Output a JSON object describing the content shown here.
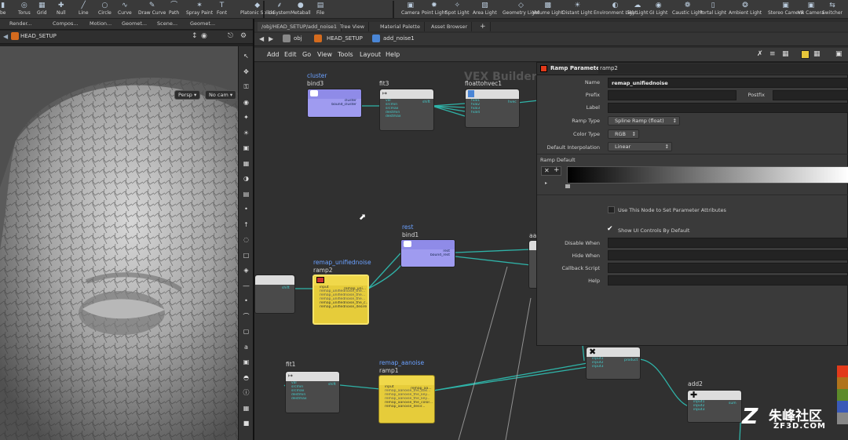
{
  "shelf": {
    "left_tools": [
      {
        "label": "be",
        "icon": "tube-icon"
      },
      {
        "label": "Torus",
        "icon": "torus-icon"
      },
      {
        "label": "Grid",
        "icon": "grid-icon"
      },
      {
        "label": "Null",
        "icon": "null-icon"
      },
      {
        "label": "Line",
        "icon": "line-icon"
      },
      {
        "label": "Circle",
        "icon": "circle-icon"
      },
      {
        "label": "Curve",
        "icon": "curve-icon"
      },
      {
        "label": "Draw Curve",
        "icon": "draw-curve-icon"
      },
      {
        "label": "Path",
        "icon": "path-icon"
      },
      {
        "label": "Spray Paint",
        "icon": "spray-paint-icon"
      },
      {
        "label": "Font",
        "icon": "font-icon"
      },
      {
        "label": "Platonic Solids",
        "icon": "platonic-icon"
      },
      {
        "label": "L-System",
        "icon": "lsystem-icon"
      },
      {
        "label": "Metaball",
        "icon": "metaball-icon"
      },
      {
        "label": "File",
        "icon": "file-icon"
      }
    ],
    "right_tools": [
      {
        "label": "Camera",
        "icon": "camera-icon"
      },
      {
        "label": "Point Light",
        "icon": "point-light-icon"
      },
      {
        "label": "Spot Light",
        "icon": "spot-light-icon"
      },
      {
        "label": "Area Light",
        "icon": "area-light-icon"
      },
      {
        "label": "Geometry Light",
        "icon": "geometry-light-icon"
      },
      {
        "label": "Volume Light",
        "icon": "volume-light-icon"
      },
      {
        "label": "Distant Light",
        "icon": "distant-light-icon"
      },
      {
        "label": "Environment Light",
        "icon": "environment-light-icon"
      },
      {
        "label": "Sky Light",
        "icon": "sky-light-icon"
      },
      {
        "label": "GI Light",
        "icon": "gi-light-icon"
      },
      {
        "label": "Caustic Light",
        "icon": "caustic-light-icon"
      },
      {
        "label": "Portal Light",
        "icon": "portal-light-icon"
      },
      {
        "label": "Ambient Light",
        "icon": "ambient-light-icon"
      },
      {
        "label": "Stereo Camera",
        "icon": "stereo-camera-icon"
      },
      {
        "label": "VR Camera",
        "icon": "vr-camera-icon"
      },
      {
        "label": "Switcher",
        "icon": "switcher-icon"
      }
    ]
  },
  "left": {
    "tabs": [
      "Render...",
      "Compos...",
      "Motion...",
      "Geomet...",
      "Scene...",
      "Geomet..."
    ],
    "path": "HEAD_SETUP",
    "persp_btn": "Persp ▾",
    "cam_btn": "No cam ▾"
  },
  "right": {
    "tabs": [
      "/obj/HEAD_SETUP/add_noise1",
      "Tree View",
      "Material Palette",
      "Asset Browser",
      "+"
    ],
    "path": {
      "obj": "obj",
      "head": "HEAD_SETUP",
      "node": "add_noise1"
    },
    "menu": [
      "Add",
      "Edit",
      "Go",
      "View",
      "Tools",
      "Layout",
      "Help"
    ],
    "watermark": "VEX Builder"
  },
  "nodes": {
    "cluster_type": "cluster",
    "bind3": "bind3",
    "bind3_port1": "cluster",
    "bind3_port2": "bound_cluster",
    "fit3": "fit3",
    "fit3_ports": [
      "val",
      "srcmin",
      "srcmax",
      "destmin",
      "destmax"
    ],
    "fit3_out": "shift",
    "floattohvec1": "floattohvec1",
    "fhv_ports": [
      "fval1",
      "fval2",
      "fval3",
      "fval4"
    ],
    "fhv_out": "hvec",
    "rest_type": "rest",
    "bind1": "bind1",
    "bind1_port1": "rest",
    "bind1_port2": "bound_rest",
    "aa_label": "aa",
    "remap_unified_type": "remap_unifiednoise",
    "ramp2": "ramp2",
    "ramp2_ports": [
      "input",
      "remap_unifiednoise_the...",
      "remap_unifiednoise_the...",
      "remap_unifiednoise_the...",
      "remap_unifiednoise_the_c...",
      "remap_unifiednoise_desire"
    ],
    "ramp2_out": "remap_uni...",
    "left_node_out": "shift",
    "fit1": "fit1",
    "fit1_ports": [
      "val",
      "srcmin",
      "srcmax",
      "destmin",
      "destmax"
    ],
    "fit1_out": "shift",
    "remap_aanoise_type": "remap_aanoise",
    "ramp1": "ramp1",
    "ramp1_ports": [
      "input",
      "remap_aanoise_the_bas...",
      "remap_aanoise_the_key...",
      "remap_aanoise_the_key...",
      "remap_aanoise_the_color...",
      "remap_aanoise_desir..."
    ],
    "ramp1_out": "remap_aa...",
    "mult_ports": [
      "input1",
      "input2",
      "input3"
    ],
    "mult_out": "product",
    "add2": "add2",
    "add2_ports": [
      "input1",
      "input2",
      "input3"
    ],
    "add2_out": "sum"
  },
  "param": {
    "header_title": "Ramp Parameter",
    "header_value": "ramp2",
    "name_label": "Name",
    "name_value": "remap_unifiednoise",
    "prefix_label": "Prefix",
    "postfix_label": "Postfix",
    "label_label": "Label",
    "ramp_type_label": "Ramp Type",
    "ramp_type_value": "Spline Ramp (float)",
    "color_type_label": "Color Type",
    "color_type_value": "RGB",
    "default_interp_label": "Default Interpolation",
    "default_interp_value": "Linear",
    "ramp_default_label": "Ramp Default",
    "use_node_label": "Use This Node to Set Parameter Attributes",
    "use_node_checked": false,
    "show_ui_label": "Show UI Controls By Default",
    "show_ui_checked": true,
    "disable_when_label": "Disable When",
    "hide_when_label": "Hide When",
    "callback_label": "Callback Script",
    "help_label": "Help"
  },
  "watermark": {
    "title": "朱峰社区",
    "url": "ZF3D.COM"
  },
  "colors": {
    "node_yellow": "#f0d84a",
    "node_purple": "#8f8be8",
    "wire": "#2fb3a8",
    "swatches": [
      "#e23a1a",
      "#b0731b",
      "#5c8a2a",
      "#3a5ab8",
      "#888888"
    ]
  }
}
